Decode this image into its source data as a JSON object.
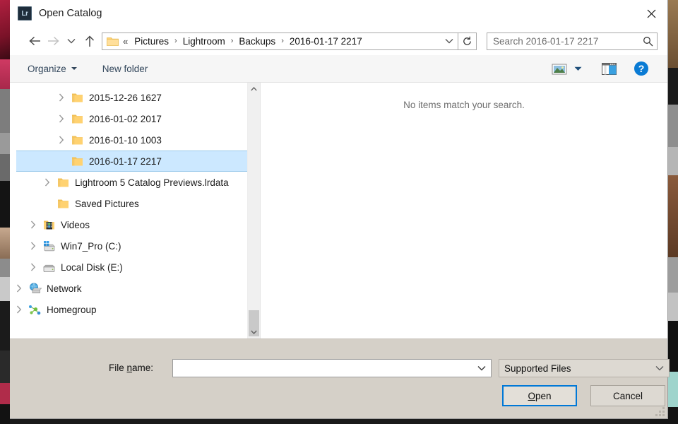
{
  "window": {
    "title": "Open Catalog",
    "app_icon": "lightroom-icon",
    "app_icon_text": "Lr",
    "close_label": "✕"
  },
  "navbar": {
    "back_icon": "back-arrow-icon",
    "forward_icon": "forward-arrow-icon",
    "recent_icon": "recent-locations-chevron-icon",
    "up_icon": "up-arrow-icon",
    "breadcrumb_overflow": "«",
    "breadcrumbs": [
      {
        "label": "Pictures"
      },
      {
        "label": "Lightroom"
      },
      {
        "label": "Backups"
      },
      {
        "label": "2016-01-17 2217"
      }
    ],
    "separator": "›",
    "dropdown_icon": "address-dropdown-icon",
    "refresh_icon": "refresh-icon"
  },
  "search": {
    "placeholder": "Search 2016-01-17 2217",
    "value": "",
    "icon": "search-icon"
  },
  "toolbar": {
    "organize_label": "Organize",
    "new_folder_label": "New folder",
    "view_icon": "view-layout-icon",
    "view_caret_icon": "chevron-down-icon",
    "preview_pane_icon": "preview-pane-icon",
    "help_icon": "help-icon",
    "help_glyph": "?"
  },
  "tree": {
    "items": [
      {
        "label": "2015-12-26 1627",
        "icon": "folder-icon",
        "indent": 62,
        "expander": true,
        "selected": false
      },
      {
        "label": "2016-01-02 2017",
        "icon": "folder-icon",
        "indent": 62,
        "expander": true,
        "selected": false
      },
      {
        "label": "2016-01-10 1003",
        "icon": "folder-icon",
        "indent": 62,
        "expander": true,
        "selected": false
      },
      {
        "label": "2016-01-17 2217",
        "icon": "folder-icon",
        "indent": 62,
        "expander": false,
        "selected": true
      },
      {
        "label": "Lightroom 5 Catalog Previews.lrdata",
        "icon": "folder-icon",
        "indent": 42,
        "expander": true,
        "selected": false
      },
      {
        "label": "Saved Pictures",
        "icon": "folder-icon",
        "indent": 42,
        "expander": false,
        "selected": false
      },
      {
        "label": "Videos",
        "icon": "videos-folder-icon",
        "indent": 22,
        "expander": true,
        "selected": false
      },
      {
        "label": "Win7_Pro (C:)",
        "icon": "system-drive-icon",
        "indent": 22,
        "expander": true,
        "selected": false
      },
      {
        "label": "Local Disk (E:)",
        "icon": "drive-icon",
        "indent": 22,
        "expander": true,
        "selected": false
      },
      {
        "label": "Network",
        "icon": "network-icon",
        "indent": 2,
        "expander": true,
        "selected": false
      },
      {
        "label": "Homegroup",
        "icon": "homegroup-icon",
        "indent": 2,
        "expander": true,
        "selected": false
      }
    ],
    "scrollbar": {
      "up_icon": "scroll-up-icon",
      "down_icon": "scroll-down-icon"
    }
  },
  "content": {
    "empty_message": "No items match your search."
  },
  "footer": {
    "filename_label_prefix": "File ",
    "filename_label_accel": "n",
    "filename_label_suffix": "ame:",
    "filename_value": "",
    "filename_caret_icon": "chevron-down-icon",
    "filetype_value": "Supported Files",
    "filetype_caret_icon": "chevron-down-icon",
    "open_prefix": "",
    "open_accel": "O",
    "open_suffix": "pen",
    "cancel_label": "Cancel",
    "resize_grip": "resize-grip-icon"
  },
  "colors": {
    "accent": "#0078d7",
    "selection": "#cce8ff",
    "selection_border": "#9ac9ea",
    "footer_bg": "#d5d0c8",
    "toolbar_bg": "#f6f6f6",
    "folder_yellow": "#ffd271",
    "link_text": "#33475c"
  }
}
